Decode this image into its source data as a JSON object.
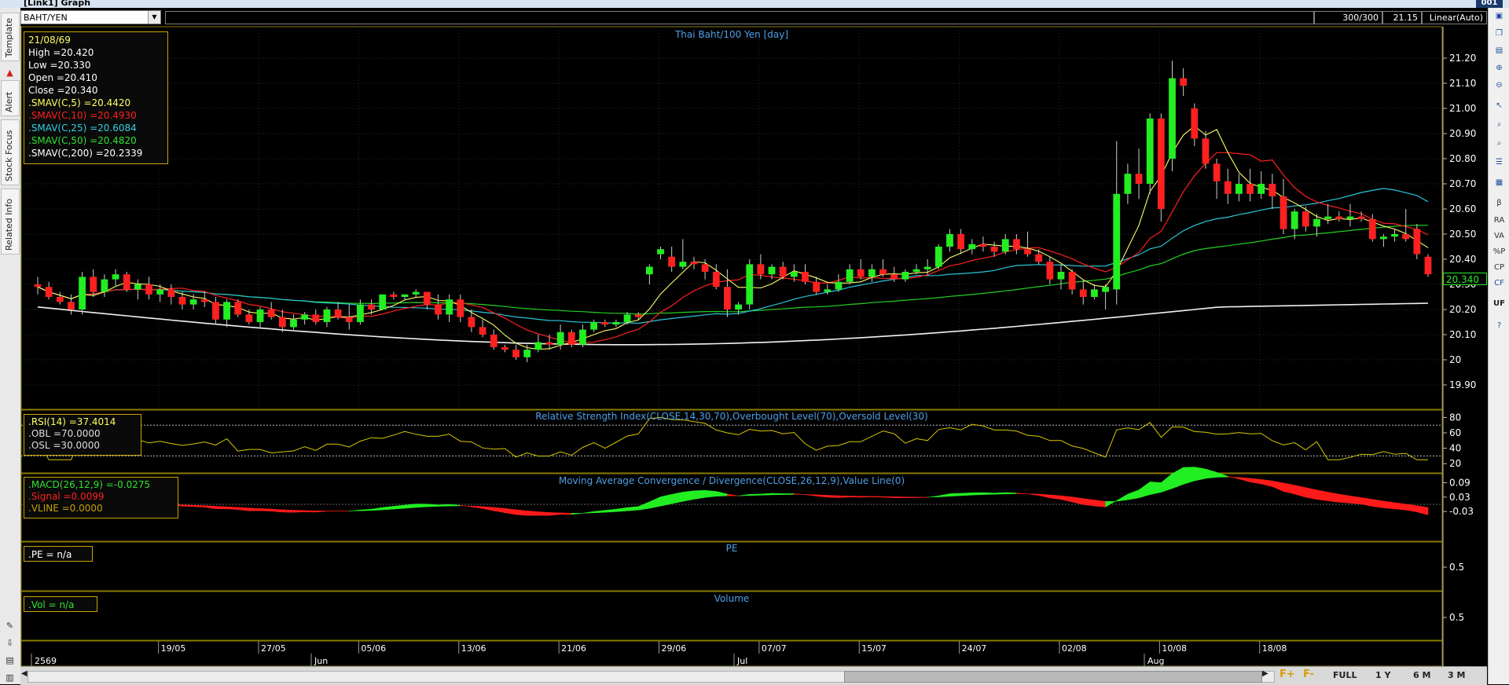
{
  "window": {
    "title": "[Link1] Graph",
    "corner_button": "001"
  },
  "left_tabs": [
    "Template",
    "Alert",
    "Stock Focus",
    "Related Info"
  ],
  "symbol": "BAHT/YEN",
  "top_right": {
    "counter": "300/300",
    "value": "21.15",
    "scale": "Linear(Auto)"
  },
  "right_toolbar": [
    "RA",
    "VA",
    "%P",
    "CP",
    "CF",
    "UF"
  ],
  "main_panel": {
    "title": "Thai Baht/100 Yen [day]",
    "info": {
      "date": "21/08/69",
      "lines": [
        {
          "text": "High  =20.420",
          "color": "#ffffff"
        },
        {
          "text": "Low   =20.330",
          "color": "#ffffff"
        },
        {
          "text": "Open  =20.410",
          "color": "#ffffff"
        },
        {
          "text": "Close  =20.340",
          "color": "#ffffff"
        },
        {
          "text": ".SMAV(C,5)    =20.4420",
          "color": "#ffff66"
        },
        {
          "text": ".SMAV(C,10)    =20.4930",
          "color": "#ff2020"
        },
        {
          "text": ".SMAV(C,25)    =20.6084",
          "color": "#30d0e0"
        },
        {
          "text": ".SMAV(C,50)    =20.4820",
          "color": "#30e030"
        },
        {
          "text": ".SMAV(C,200)    =20.2339",
          "color": "#ffffff"
        }
      ]
    },
    "y_ticks": [
      "21.20",
      "21.10",
      "21.00",
      "20.90",
      "20.80",
      "20.70",
      "20.60",
      "20.50",
      "20.40",
      "20.30",
      "20.20",
      "20.10",
      "20",
      "19.90"
    ],
    "last_price": "20.340"
  },
  "rsi_panel": {
    "title": "Relative Strength Index(CLOSE,14,30,70),Overbought Level(70),Oversold Level(30)",
    "lines": [
      {
        "text": ".RSI(14)    =37.4014",
        "color": "#ffff66"
      },
      {
        "text": ".OBL    =70.0000",
        "color": "#dddddd"
      },
      {
        "text": ".OSL    =30.0000",
        "color": "#dddddd"
      }
    ],
    "y_ticks": [
      "80",
      "60",
      "40",
      "20"
    ]
  },
  "macd_panel": {
    "title": "Moving Average Convergence / Divergence(CLOSE,26,12,9),Value Line(0)",
    "lines": [
      {
        "text": ".MACD(26,12,9)    =-0.0275",
        "color": "#30e030"
      },
      {
        "text": ".Signal    =0.0099",
        "color": "#ff2020"
      },
      {
        "text": ".VLINE    =0.0000",
        "color": "#c8a000"
      }
    ],
    "y_ticks": [
      "0.09",
      "0.03",
      "-0.03"
    ]
  },
  "pe_panel": {
    "title": "PE",
    "label": ".PE    = n/a",
    "y_tick": "0.5"
  },
  "vol_panel": {
    "title": "Volume",
    "label": ".Vol    = n/a",
    "y_tick": "0.5"
  },
  "x_axis": {
    "dates": [
      "19/05",
      "27/05",
      "05/06",
      "13/06",
      "21/06",
      "29/06",
      "07/07",
      "15/07",
      "24/07",
      "02/08",
      "10/08",
      "18/08"
    ],
    "months": [
      "2569",
      "Jun",
      "Jul",
      "Aug"
    ]
  },
  "bottom_bar": {
    "f_plus": "F+",
    "f_minus": "F-",
    "full": "FULL",
    "y1": "1 Y",
    "m6": "6 M",
    "m3": "3 M"
  },
  "chart_data": {
    "type": "candlestick",
    "title": "Thai Baht/100 Yen [day]",
    "ylim": [
      19.85,
      21.27
    ],
    "candles": [
      [
        20.3,
        20.33,
        20.26,
        20.29
      ],
      [
        20.29,
        20.31,
        20.24,
        20.25
      ],
      [
        20.25,
        20.27,
        20.22,
        20.23
      ],
      [
        20.23,
        20.26,
        20.18,
        20.2
      ],
      [
        20.2,
        20.35,
        20.18,
        20.33
      ],
      [
        20.33,
        20.36,
        20.25,
        20.27
      ],
      [
        20.27,
        20.34,
        20.25,
        20.32
      ],
      [
        20.32,
        20.36,
        20.29,
        20.34
      ],
      [
        20.34,
        20.35,
        20.27,
        20.28
      ],
      [
        20.28,
        20.32,
        20.24,
        20.3
      ],
      [
        20.3,
        20.33,
        20.24,
        20.26
      ],
      [
        20.26,
        20.3,
        20.23,
        20.28
      ],
      [
        20.28,
        20.3,
        20.22,
        20.25
      ],
      [
        20.25,
        20.27,
        20.2,
        20.22
      ],
      [
        20.22,
        20.26,
        20.2,
        20.24
      ],
      [
        20.24,
        20.27,
        20.21,
        20.23
      ],
      [
        20.23,
        20.25,
        20.14,
        20.16
      ],
      [
        20.16,
        20.24,
        20.13,
        20.23
      ],
      [
        20.23,
        20.24,
        20.17,
        20.18
      ],
      [
        20.18,
        20.2,
        20.14,
        20.15
      ],
      [
        20.15,
        20.21,
        20.13,
        20.2
      ],
      [
        20.2,
        20.23,
        20.16,
        20.17
      ],
      [
        20.17,
        20.2,
        20.11,
        20.13
      ],
      [
        20.13,
        20.18,
        20.12,
        20.16
      ],
      [
        20.16,
        20.19,
        20.14,
        20.18
      ],
      [
        20.18,
        20.2,
        20.14,
        20.15
      ],
      [
        20.15,
        20.21,
        20.13,
        20.2
      ],
      [
        20.2,
        20.23,
        20.16,
        20.17
      ],
      [
        20.17,
        20.22,
        20.12,
        20.15
      ],
      [
        20.15,
        20.24,
        20.14,
        20.22
      ],
      [
        20.22,
        20.24,
        20.18,
        20.2
      ],
      [
        20.2,
        20.26,
        20.2,
        20.26
      ],
      [
        20.26,
        20.27,
        20.24,
        20.25
      ],
      [
        20.25,
        20.26,
        20.24,
        20.26
      ],
      [
        20.26,
        20.28,
        20.25,
        20.27
      ],
      [
        20.27,
        20.27,
        20.2,
        20.22
      ],
      [
        20.22,
        20.26,
        20.16,
        20.18
      ],
      [
        20.18,
        20.26,
        20.15,
        20.24
      ],
      [
        20.24,
        20.26,
        20.15,
        20.17
      ],
      [
        20.17,
        20.2,
        20.11,
        20.13
      ],
      [
        20.13,
        20.16,
        20.09,
        20.1
      ],
      [
        20.1,
        20.12,
        20.04,
        20.05
      ],
      [
        20.05,
        20.06,
        20.03,
        20.04
      ],
      [
        20.04,
        20.06,
        20.0,
        20.01
      ],
      [
        20.01,
        20.06,
        19.99,
        20.04
      ],
      [
        20.04,
        20.1,
        20.03,
        20.07
      ],
      [
        20.07,
        20.1,
        20.04,
        20.06
      ],
      [
        20.06,
        20.14,
        20.04,
        20.11
      ],
      [
        20.11,
        20.12,
        20.05,
        20.06
      ],
      [
        20.06,
        20.14,
        20.05,
        20.12
      ],
      [
        20.12,
        20.16,
        20.11,
        20.15
      ],
      [
        20.15,
        20.16,
        20.13,
        20.14
      ],
      [
        20.14,
        20.16,
        20.13,
        20.15
      ],
      [
        20.15,
        20.19,
        20.14,
        20.18
      ],
      [
        20.18,
        20.19,
        20.16,
        20.17
      ],
      [
        20.34,
        20.38,
        20.3,
        20.37
      ],
      [
        20.42,
        20.45,
        20.4,
        20.44
      ],
      [
        20.41,
        20.45,
        20.35,
        20.37
      ],
      [
        20.37,
        20.48,
        20.36,
        20.39
      ],
      [
        20.39,
        20.41,
        20.36,
        20.38
      ],
      [
        20.38,
        20.4,
        20.32,
        20.35
      ],
      [
        20.35,
        20.38,
        20.28,
        20.29
      ],
      [
        20.29,
        20.36,
        20.17,
        20.2
      ],
      [
        20.2,
        20.23,
        20.18,
        20.22
      ],
      [
        20.22,
        20.4,
        20.2,
        20.38
      ],
      [
        20.38,
        20.42,
        20.32,
        20.34
      ],
      [
        20.34,
        20.38,
        20.32,
        20.37
      ],
      [
        20.37,
        20.39,
        20.32,
        20.33
      ],
      [
        20.33,
        20.38,
        20.31,
        20.35
      ],
      [
        20.35,
        20.38,
        20.3,
        20.31
      ],
      [
        20.31,
        20.33,
        20.26,
        20.27
      ],
      [
        20.27,
        20.3,
        20.26,
        20.28
      ],
      [
        20.28,
        20.34,
        20.27,
        20.31
      ],
      [
        20.31,
        20.38,
        20.3,
        20.36
      ],
      [
        20.36,
        20.4,
        20.32,
        20.33
      ],
      [
        20.33,
        20.38,
        20.31,
        20.36
      ],
      [
        20.36,
        20.4,
        20.33,
        20.34
      ],
      [
        20.34,
        20.37,
        20.31,
        20.32
      ],
      [
        20.32,
        20.36,
        20.31,
        20.35
      ],
      [
        20.35,
        20.38,
        20.34,
        20.36
      ],
      [
        20.36,
        20.4,
        20.34,
        20.37
      ],
      [
        20.37,
        20.46,
        20.36,
        20.45
      ],
      [
        20.45,
        20.52,
        20.43,
        20.5
      ],
      [
        20.5,
        20.52,
        20.42,
        20.44
      ],
      [
        20.44,
        20.48,
        20.42,
        20.46
      ],
      [
        20.46,
        20.49,
        20.43,
        20.45
      ],
      [
        20.45,
        20.47,
        20.41,
        20.43
      ],
      [
        20.43,
        20.5,
        20.42,
        20.48
      ],
      [
        20.48,
        20.5,
        20.42,
        20.44
      ],
      [
        20.44,
        20.51,
        20.41,
        20.42
      ],
      [
        20.42,
        20.44,
        20.38,
        20.39
      ],
      [
        20.39,
        20.41,
        20.3,
        20.32
      ],
      [
        20.32,
        20.38,
        20.28,
        20.35
      ],
      [
        20.35,
        20.36,
        20.26,
        20.28
      ],
      [
        20.28,
        20.32,
        20.22,
        20.25
      ],
      [
        20.25,
        20.3,
        20.24,
        20.28
      ],
      [
        20.27,
        20.3,
        20.2,
        20.29
      ],
      [
        20.28,
        20.87,
        20.22,
        20.66
      ],
      [
        20.66,
        20.78,
        20.62,
        20.74
      ],
      [
        20.74,
        20.84,
        20.64,
        20.7
      ],
      [
        20.7,
        20.98,
        20.66,
        20.96
      ],
      [
        20.96,
        20.98,
        20.55,
        20.6
      ],
      [
        20.8,
        21.19,
        20.75,
        21.12
      ],
      [
        21.12,
        21.16,
        21.05,
        21.09
      ],
      [
        21.0,
        21.02,
        20.85,
        20.88
      ],
      [
        20.88,
        20.91,
        20.76,
        20.78
      ],
      [
        20.78,
        20.8,
        20.64,
        20.71
      ],
      [
        20.71,
        20.76,
        20.62,
        20.66
      ],
      [
        20.66,
        20.74,
        20.63,
        20.7
      ],
      [
        20.7,
        20.76,
        20.63,
        20.66
      ],
      [
        20.66,
        20.75,
        20.64,
        20.7
      ],
      [
        20.7,
        20.74,
        20.6,
        20.65
      ],
      [
        20.65,
        20.72,
        20.5,
        20.52
      ],
      [
        20.52,
        20.6,
        20.48,
        20.59
      ],
      [
        20.59,
        20.61,
        20.51,
        20.53
      ],
      [
        20.53,
        20.58,
        20.49,
        20.56
      ],
      [
        20.56,
        20.62,
        20.54,
        20.57
      ],
      [
        20.57,
        20.59,
        20.55,
        20.56
      ],
      [
        20.56,
        20.62,
        20.53,
        20.57
      ],
      [
        20.57,
        20.59,
        20.55,
        20.56
      ],
      [
        20.56,
        20.58,
        20.47,
        20.48
      ],
      [
        20.48,
        20.5,
        20.45,
        20.49
      ],
      [
        20.49,
        20.52,
        20.47,
        20.5
      ],
      [
        20.5,
        20.6,
        20.47,
        20.48
      ],
      [
        20.52,
        20.54,
        20.4,
        20.42
      ],
      [
        20.41,
        20.42,
        20.33,
        20.34
      ]
    ]
  }
}
